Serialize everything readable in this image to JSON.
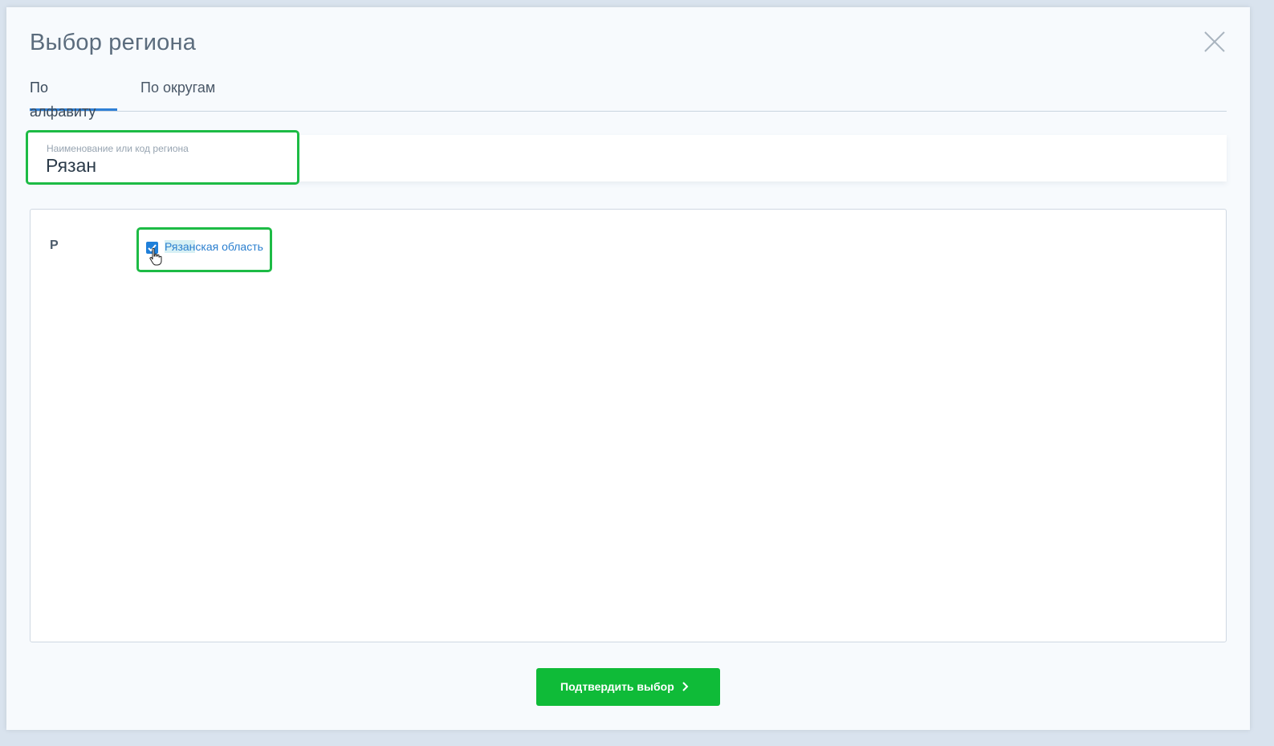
{
  "modal": {
    "title": "Выбор региона",
    "close_icon": "close-icon"
  },
  "tabs": [
    {
      "label": "По алфавиту",
      "active": true
    },
    {
      "label": "По округам",
      "active": false
    }
  ],
  "search": {
    "label": "Наименование или код региона",
    "value": "Рязан"
  },
  "list": {
    "groups": [
      {
        "letter": "Р",
        "items": [
          {
            "match": "Рязан",
            "rest": "ская область",
            "checked": true
          }
        ]
      }
    ]
  },
  "confirm": {
    "label": "Подтвердить выбор",
    "icon": "chevron-right-icon"
  },
  "colors": {
    "accent_green": "#0fbb38",
    "highlight_border": "#1dbb45",
    "link_blue": "#2b7fcf",
    "tab_active": "#2f80d6"
  }
}
